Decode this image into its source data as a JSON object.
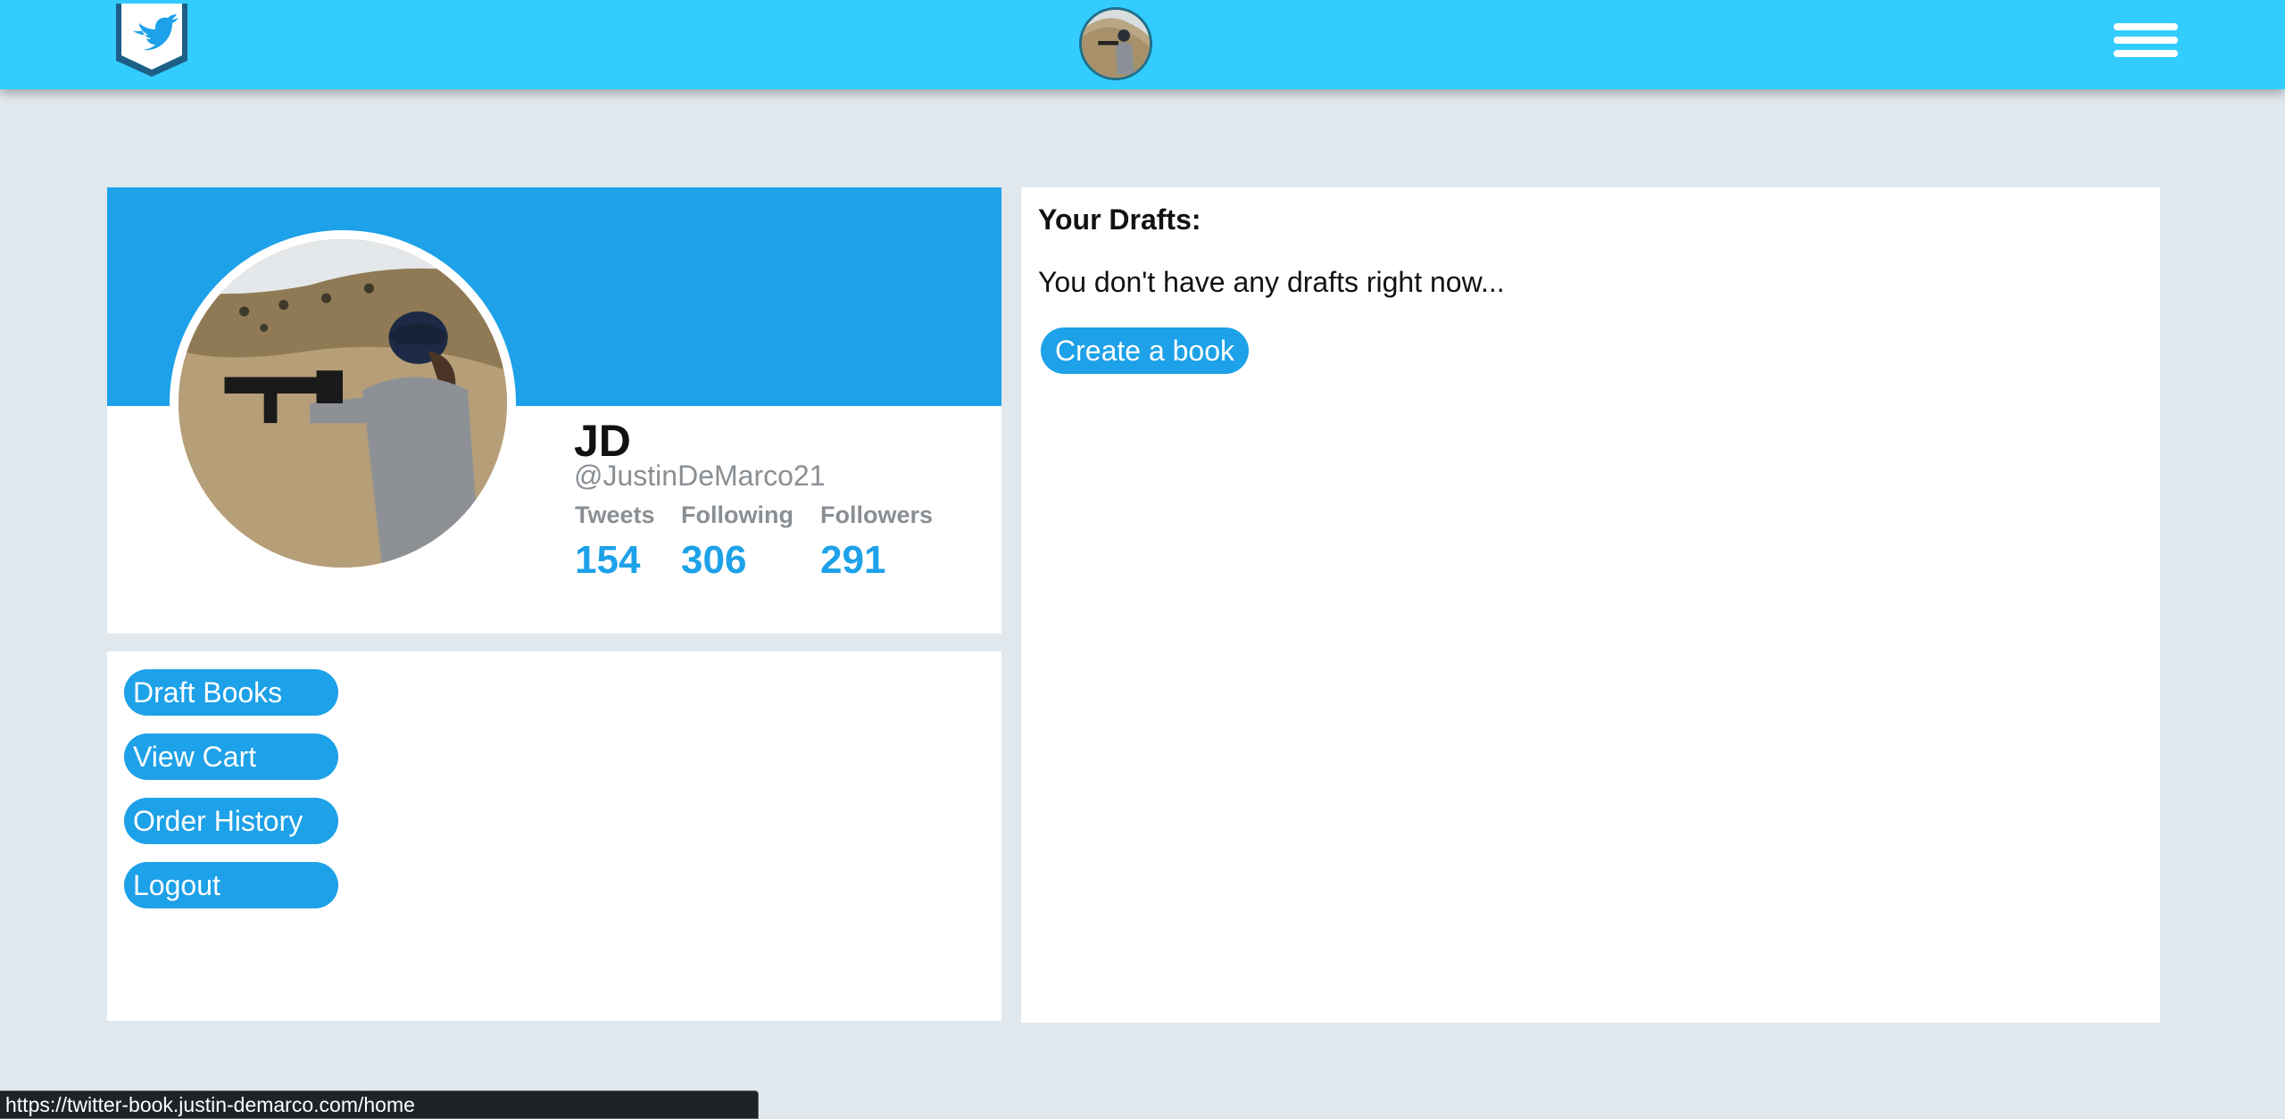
{
  "header": {
    "logo_icon": "twitter-bird-book-icon",
    "avatar_icon": "user-avatar",
    "menu_icon": "hamburger-menu-icon"
  },
  "profile": {
    "name": "JD",
    "handle": "@JustinDeMarco21",
    "stats": [
      {
        "label": "Tweets",
        "value": "154"
      },
      {
        "label": "Following",
        "value": "306"
      },
      {
        "label": "Followers",
        "value": "291"
      }
    ]
  },
  "menu": {
    "items": [
      {
        "label": "Draft Books"
      },
      {
        "label": "View Cart"
      },
      {
        "label": "Order History"
      },
      {
        "label": "Logout"
      }
    ]
  },
  "drafts": {
    "title": "Your Drafts:",
    "empty_message": "You don't have any drafts right now...",
    "create_button": "Create a book"
  },
  "status_bar": {
    "url": "https://twitter-book.justin-demarco.com/home"
  },
  "colors": {
    "header": "#33ccff",
    "accent": "#1da1e8",
    "background": "#e1e8ed",
    "muted_text": "#8a8f94"
  }
}
